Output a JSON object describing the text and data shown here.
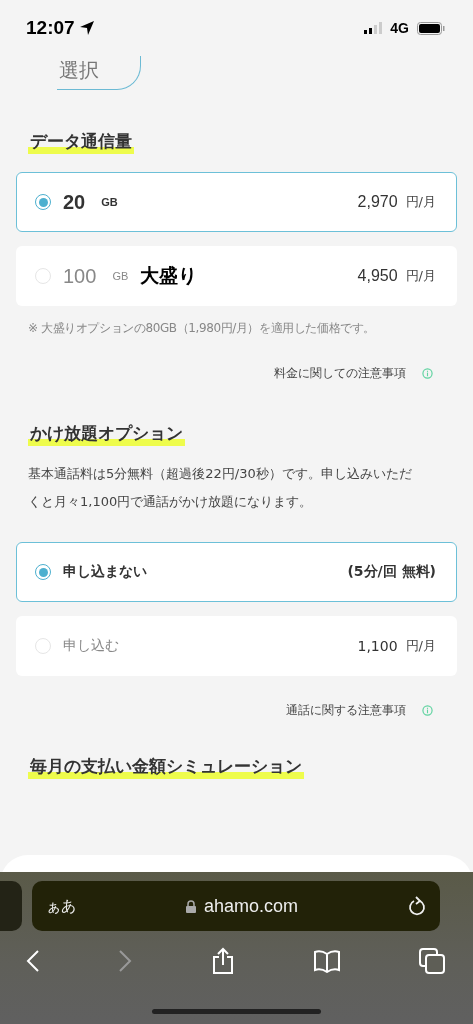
{
  "status_bar": {
    "time": "12:07",
    "network": "4G"
  },
  "top_button": {
    "label": "選択"
  },
  "data_section": {
    "heading": "データ通信量",
    "options": [
      {
        "amount": "20",
        "unit": "GB",
        "price": "2,970",
        "price_unit": "円/月",
        "selected": true
      },
      {
        "amount": "100",
        "unit": "GB",
        "badge": "大盛り",
        "price": "4,950",
        "price_unit": "円/月",
        "selected": false
      }
    ],
    "note": "※ 大盛りオプションの80GB（1,980円/月）を適用した価格です。",
    "link": "料金に関しての注意事項"
  },
  "call_section": {
    "heading": "かけ放題オプション",
    "description": "基本通話料は5分無料（超過後22円/30秒）です。申し込みいただくと月々1,100円で通話がかけ放題になります。",
    "options": [
      {
        "label": "申し込まない",
        "price": "(5分/回 無料)",
        "selected": true
      },
      {
        "label": "申し込む",
        "price": "1,100",
        "price_unit": "円/月",
        "selected": false
      }
    ],
    "link": "通話に関する注意事項"
  },
  "simulation_section": {
    "heading": "毎月の支払い金額シミュレーション"
  },
  "browser": {
    "text_size": "ぁあ",
    "url": "ahamo.com"
  }
}
